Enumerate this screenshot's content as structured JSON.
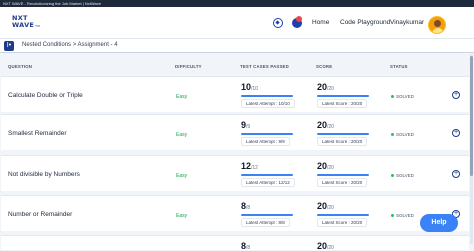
{
  "window": {
    "title": "NXT WAVE - Revolutionizing the Job Market | NxtWave"
  },
  "nav": {
    "logo_line1": "NXT",
    "logo_line2": "WAVE",
    "logo_suffix": "TM",
    "links": [
      "Home",
      "Code Playground"
    ],
    "username": "Vinaykumar",
    "icons": [
      "streak-icon",
      "notification-icon",
      "avatar"
    ]
  },
  "subheader": {
    "menu_icon": "I•",
    "breadcrumb": "Nested Conditions > Assignment - 4"
  },
  "table": {
    "headers": {
      "question": "QUESTION",
      "difficulty": "DIFFICULTY",
      "test_cases": "TEST CASES PASSED",
      "score": "SCORE",
      "status": "STATUS"
    },
    "rows": [
      {
        "title": "Calculate Double or Triple",
        "difficulty": "Easy",
        "tc_main": "10",
        "tc_total": "/10",
        "tc_detail": "Latest Attempt : 10/10",
        "score_main": "20",
        "score_total": "/20",
        "score_detail": "Latest Score : 20/20",
        "status": "SOLVED"
      },
      {
        "title": "Smallest Remainder",
        "difficulty": "Easy",
        "tc_main": "9",
        "tc_total": "/9",
        "tc_detail": "Latest Attempt : 9/9",
        "score_main": "20",
        "score_total": "/20",
        "score_detail": "Latest Score : 20/20",
        "status": "SOLVED"
      },
      {
        "title": "Not divisible by Numbers",
        "difficulty": "Easy",
        "tc_main": "12",
        "tc_total": "/12",
        "tc_detail": "Latest Attempt : 12/12",
        "score_main": "20",
        "score_total": "/20",
        "score_detail": "Latest Score : 20/20",
        "status": "SOLVED"
      },
      {
        "title": "Number or Remainder",
        "difficulty": "Easy",
        "tc_main": "8",
        "tc_total": "/8",
        "tc_detail": "Latest Attempt : 8/8",
        "score_main": "20",
        "score_total": "/20",
        "score_detail": "Latest Score : 20/20",
        "status": "SOLVED"
      },
      {
        "title": "",
        "difficulty": "",
        "tc_main": "8",
        "tc_total": "/8",
        "tc_detail": "",
        "score_main": "20",
        "score_total": "/20",
        "score_detail": "",
        "status": ""
      }
    ],
    "expand_symbol": "+"
  },
  "help": {
    "label": "Help"
  },
  "colors": {
    "brand": "#1e3a8a",
    "accent": "#3b82f6",
    "easy": "#16a34a",
    "solved_dot": "#22c55e",
    "notification": "#ef4444"
  }
}
